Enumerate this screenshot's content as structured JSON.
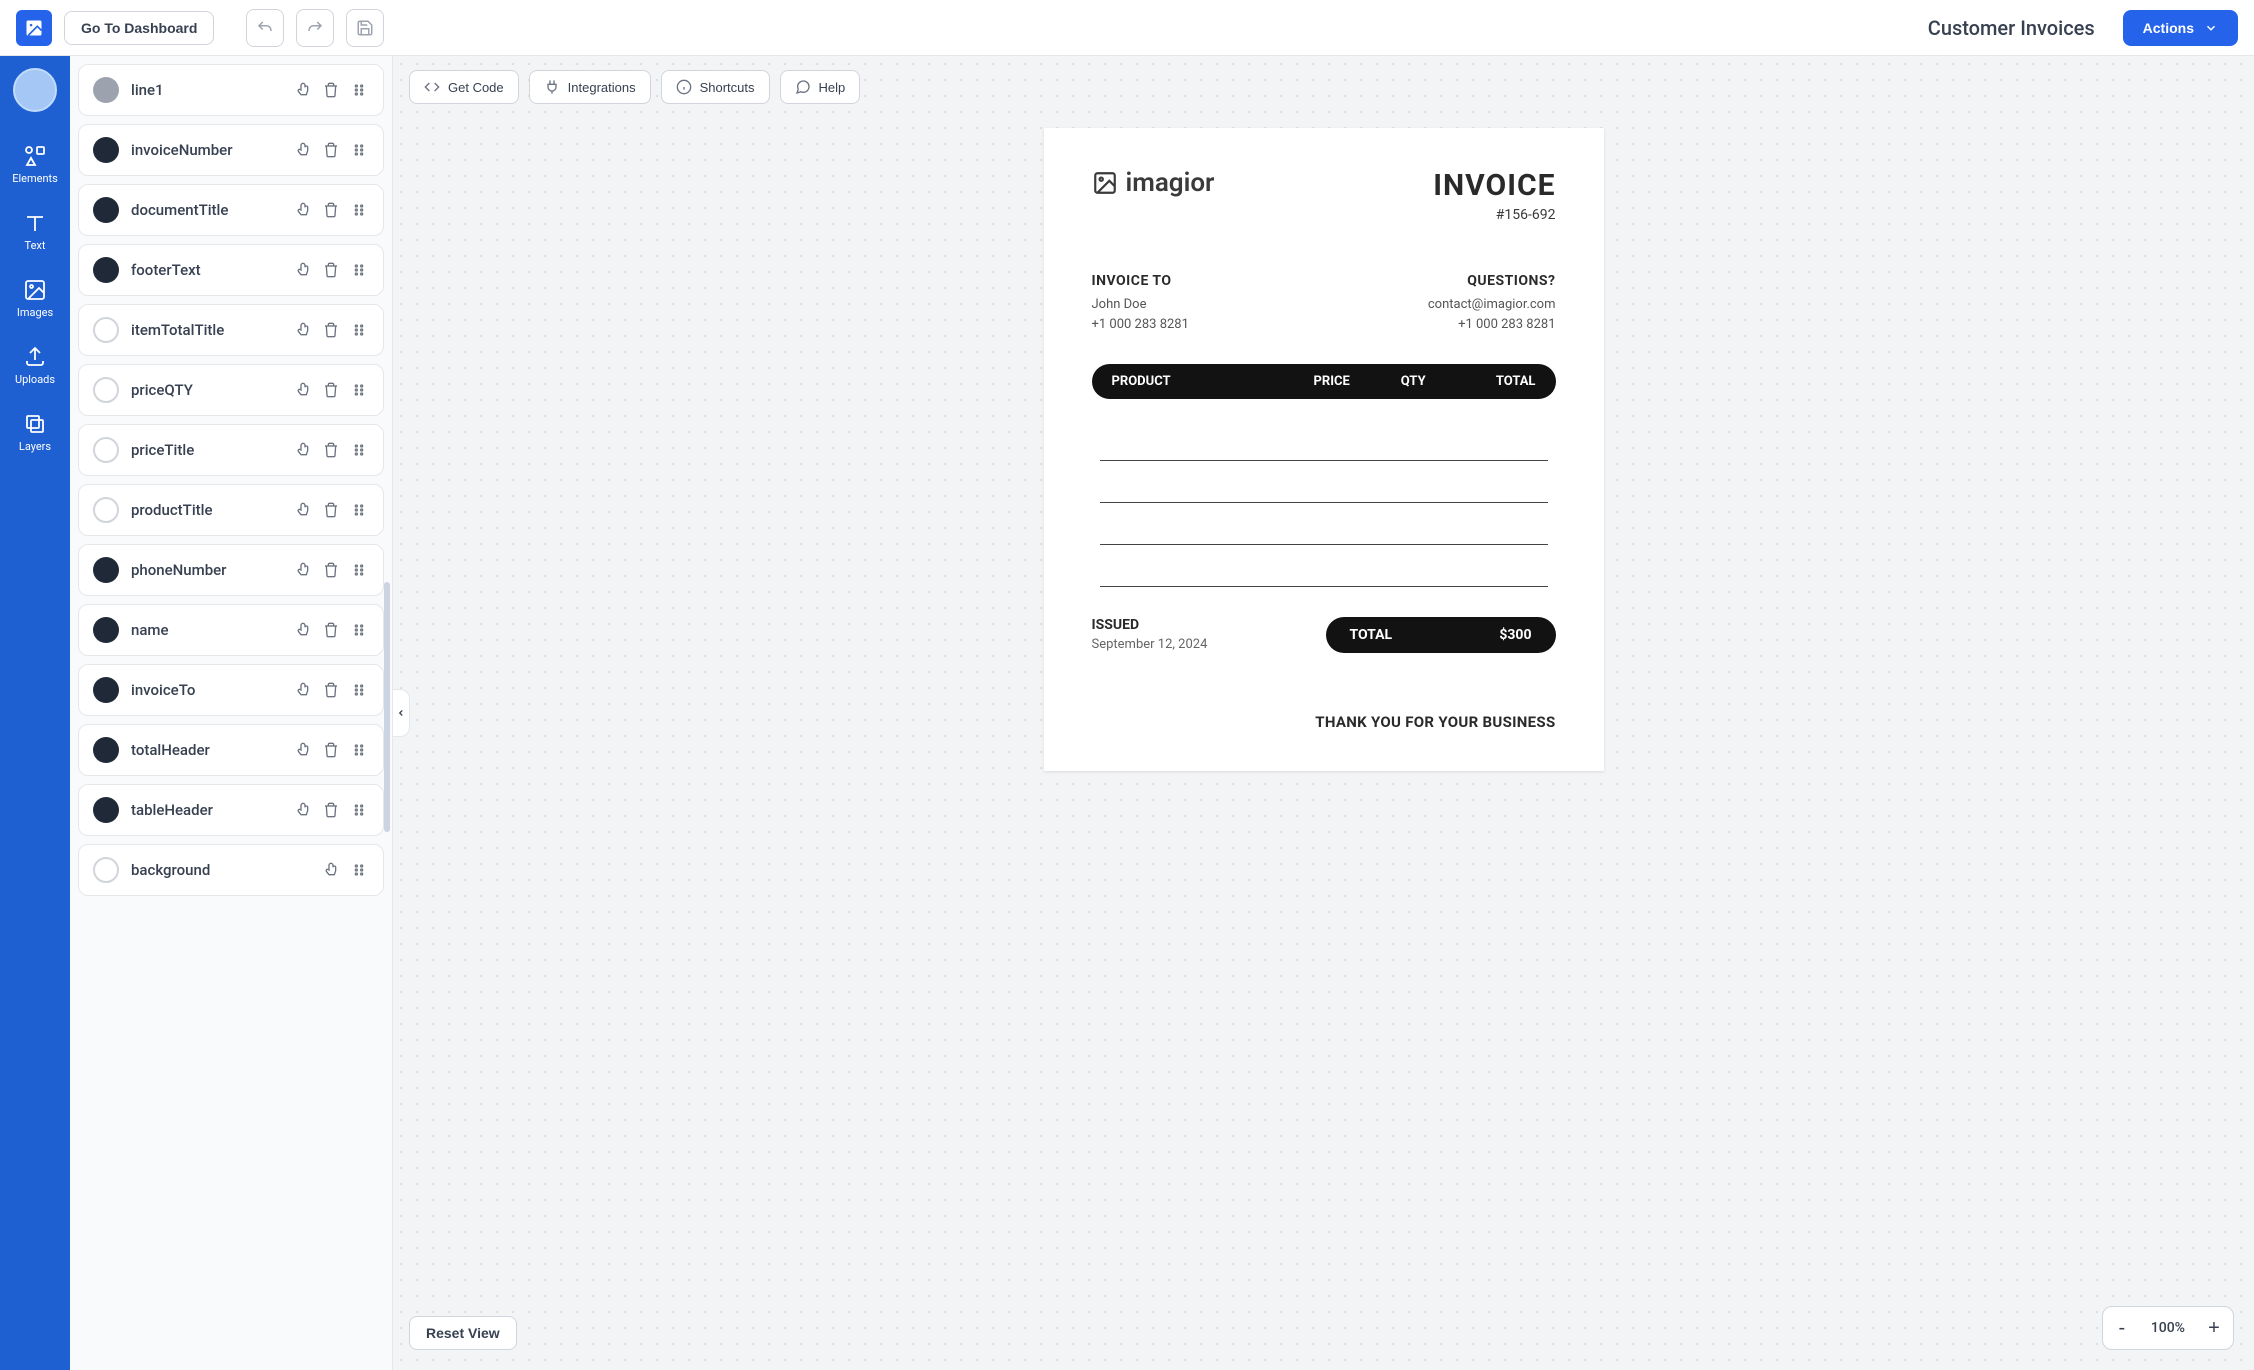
{
  "topbar": {
    "dashboard_btn": "Go To Dashboard",
    "page_title": "Customer Invoices",
    "actions_btn": "Actions"
  },
  "leftnav": {
    "items": [
      {
        "label": "Elements"
      },
      {
        "label": "Text"
      },
      {
        "label": "Images"
      },
      {
        "label": "Uploads"
      },
      {
        "label": "Layers"
      }
    ]
  },
  "layers": [
    {
      "name": "line1",
      "swatch": "gray",
      "deletable": true
    },
    {
      "name": "invoiceNumber",
      "swatch": "dark",
      "deletable": true
    },
    {
      "name": "documentTitle",
      "swatch": "dark",
      "deletable": true
    },
    {
      "name": "footerText",
      "swatch": "dark",
      "deletable": true
    },
    {
      "name": "itemTotalTitle",
      "swatch": "white",
      "deletable": true
    },
    {
      "name": "priceQTY",
      "swatch": "white",
      "deletable": true
    },
    {
      "name": "priceTitle",
      "swatch": "white",
      "deletable": true
    },
    {
      "name": "productTitle",
      "swatch": "white",
      "deletable": true
    },
    {
      "name": "phoneNumber",
      "swatch": "dark",
      "deletable": true
    },
    {
      "name": "name",
      "swatch": "dark",
      "deletable": true
    },
    {
      "name": "invoiceTo",
      "swatch": "dark",
      "deletable": true
    },
    {
      "name": "totalHeader",
      "swatch": "dark",
      "deletable": true
    },
    {
      "name": "tableHeader",
      "swatch": "dark",
      "deletable": true
    },
    {
      "name": "background",
      "swatch": "white",
      "deletable": false
    }
  ],
  "canvas_toolbar": {
    "get_code": "Get Code",
    "integrations": "Integrations",
    "shortcuts": "Shortcuts",
    "help": "Help",
    "reset_view": "Reset View"
  },
  "zoom": {
    "level": "100%"
  },
  "invoice": {
    "brand": "imagior",
    "title": "INVOICE",
    "number": "#156-692",
    "invoice_to_label": "INVOICE TO",
    "customer_name": "John Doe",
    "customer_phone": "+1 000 283 8281",
    "questions_label": "QUESTIONS?",
    "contact_email": "contact@imagior.com",
    "contact_phone": "+1 000 283 8281",
    "th_product": "PRODUCT",
    "th_price": "PRICE",
    "th_qty": "QTY",
    "th_total": "TOTAL",
    "issued_label": "ISSUED",
    "issued_date": "September 12, 2024",
    "total_label": "TOTAL",
    "total_amount": "$300",
    "footer": "THANK YOU FOR YOUR BUSINESS"
  }
}
